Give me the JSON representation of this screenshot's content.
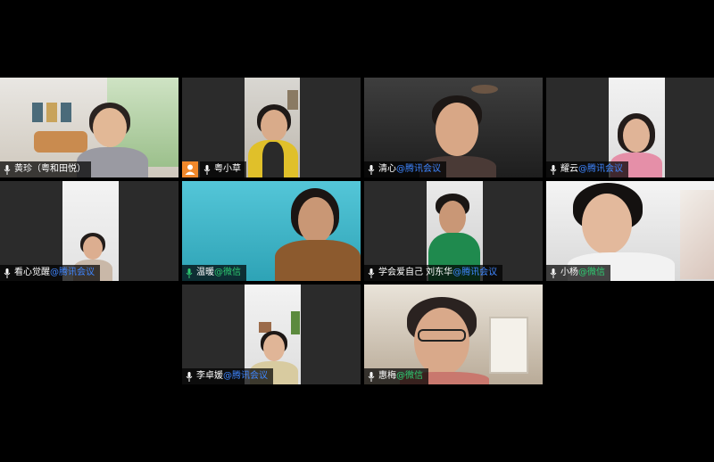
{
  "participants": [
    {
      "name": "黄珍（粤和田悦）",
      "suffix": "",
      "suffix_type": "",
      "active": true
    },
    {
      "name": "粤小草",
      "suffix": "",
      "suffix_type": "",
      "host_badge": true
    },
    {
      "name": "清心",
      "suffix": "@腾讯会议",
      "suffix_type": "tx"
    },
    {
      "name": "耀云",
      "suffix": "@腾讯会议",
      "suffix_type": "tx"
    },
    {
      "name": "看心觉醒",
      "suffix": "@腾讯会议",
      "suffix_type": "tx"
    },
    {
      "name": "温暖",
      "suffix": "@微信",
      "suffix_type": "wx"
    },
    {
      "name": "学会爱自己 刘东华",
      "suffix": "@腾讯会议",
      "suffix_type": "tx"
    },
    {
      "name": "小杨",
      "suffix": "@微信",
      "suffix_type": "wx"
    },
    {
      "name": "李卓媛",
      "suffix": "@腾讯会议",
      "suffix_type": "tx"
    },
    {
      "name": "惠梅",
      "suffix": "@微信",
      "suffix_type": "wx"
    }
  ],
  "colors": {
    "active_border": "#21b35b",
    "tencent_suffix": "#3f86ff",
    "wechat_suffix": "#2ecc71",
    "host_badge": "#f0882b"
  }
}
